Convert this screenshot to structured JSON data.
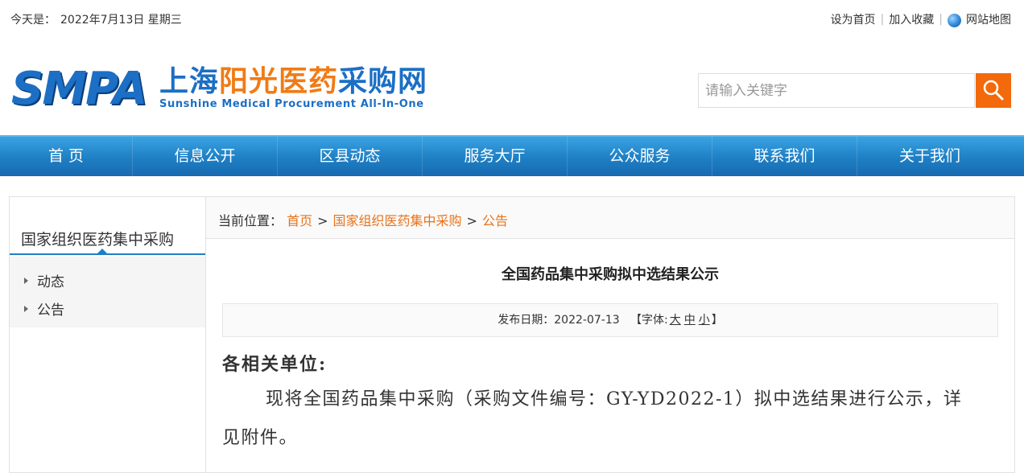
{
  "topbar": {
    "date_label": "今天是：",
    "date_value": "2022年7月13日 星期三",
    "links": [
      "设为首页",
      "加入收藏",
      "网站地图"
    ]
  },
  "logo": {
    "abbr": "SMPA",
    "cn_part1": "上海",
    "cn_part2": "阳光医药",
    "cn_part3": "采购网",
    "en": "Sunshine Medical Procurement All-In-One"
  },
  "search": {
    "placeholder": "请输入关键字",
    "icon": "search-icon",
    "button_color": "#f26a0c"
  },
  "nav": {
    "items": [
      "首 页",
      "信息公开",
      "区县动态",
      "服务大厅",
      "公众服务",
      "联系我们",
      "关于我们"
    ],
    "color": "#1f7fc4"
  },
  "sidebar": {
    "title": "国家组织医药集中采购",
    "items": [
      "动态",
      "公告"
    ]
  },
  "breadcrumb": {
    "label": "当前位置：",
    "items": [
      "首页",
      "国家组织医药集中采购",
      "公告"
    ],
    "separator": ">",
    "link_color": "#e8731c"
  },
  "article": {
    "title": "全国药品集中采购拟中选结果公示",
    "date_label": "发布日期：",
    "date": "2022-07-13",
    "font_label_open": "【字体:",
    "font_sizes": [
      "大",
      "中",
      "小"
    ],
    "font_label_close": "】",
    "greeting": "各相关单位:",
    "paragraph": "现将全国药品集中采购（采购文件编号：GY-YD2022-1）拟中选结果进行公示，详见附件。"
  }
}
